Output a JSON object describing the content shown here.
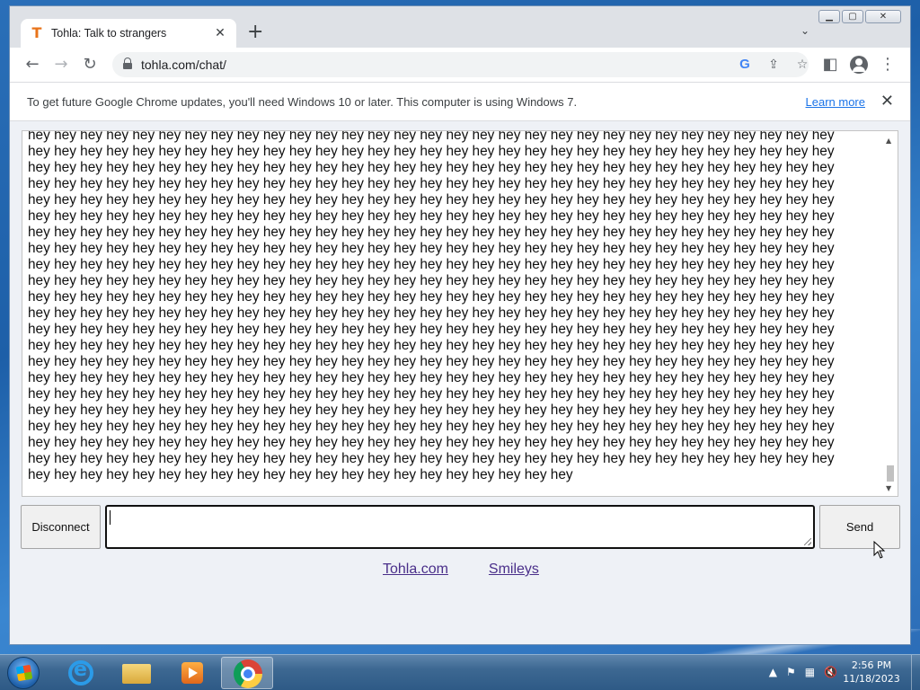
{
  "browser": {
    "tab_title": "Tohla: Talk to strangers",
    "tab_favicon": "T",
    "url": "tohla.com/chat/",
    "window_controls": {
      "minimize": "▁",
      "maximize": "▢",
      "close": "✕"
    }
  },
  "infobar": {
    "message": "To get future Google Chrome updates, you'll need Windows 10 or later. This computer is using Windows 7.",
    "learn_more": "Learn more"
  },
  "chat": {
    "word": "hey",
    "full_rows": 21,
    "words_per_row": 31,
    "last_row_words": 21,
    "input_value": ""
  },
  "buttons": {
    "disconnect": "Disconnect",
    "send": "Send"
  },
  "footer_links": {
    "home": "Tohla.com",
    "smileys": "Smileys"
  },
  "taskbar": {
    "time": "2:56 PM",
    "date": "11/18/2023"
  },
  "icons": {
    "back": "back-arrow-icon",
    "forward": "forward-arrow-icon",
    "reload": "reload-icon",
    "lock": "lock-icon",
    "google": "google-icon",
    "share": "share-icon",
    "star": "star-icon",
    "side_panel": "side-panel-icon",
    "profile": "profile-icon",
    "menu": "kebab-menu-icon"
  }
}
